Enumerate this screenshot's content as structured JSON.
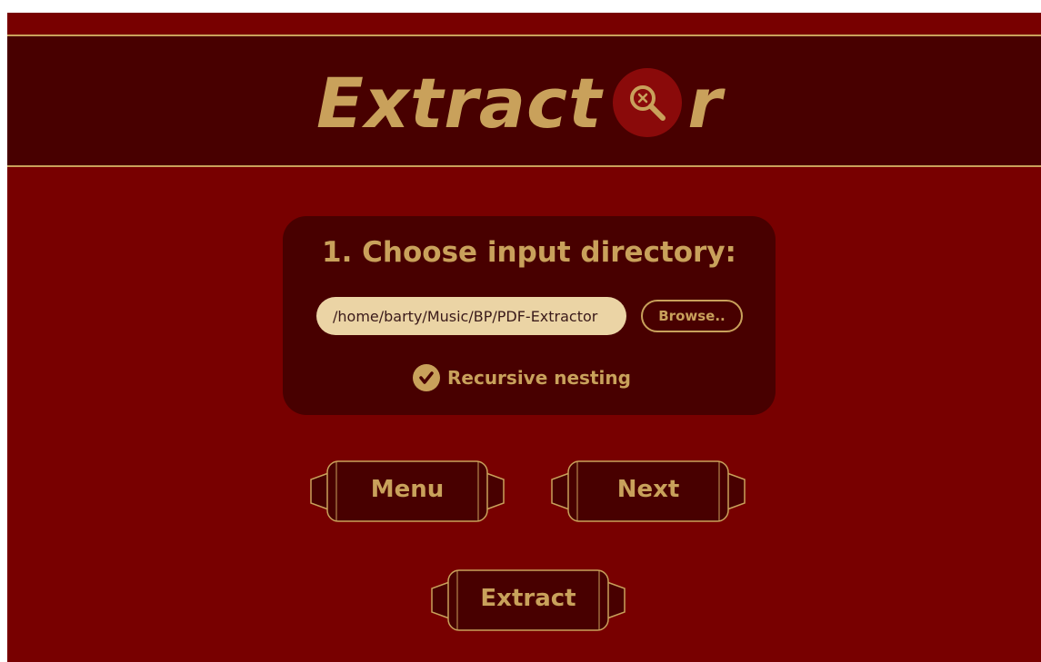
{
  "app": {
    "logo_prefix": "Extract",
    "logo_suffix": "r",
    "logo_icon": "search-x-icon"
  },
  "input_panel": {
    "title": "1. Choose input directory:",
    "path_value": "/home/barty/Music/BP/PDF-Extractor",
    "browse_label": "Browse..",
    "recursive_label": "Recursive nesting",
    "recursive_checked": true
  },
  "buttons": {
    "menu_label": "Menu",
    "next_label": "Next",
    "extract_label": "Extract"
  },
  "colors": {
    "background": "#780000",
    "header": "#480000",
    "panel": "#480000",
    "accent_gold": "#c9a15b",
    "input_fill": "#ebd4a5"
  }
}
